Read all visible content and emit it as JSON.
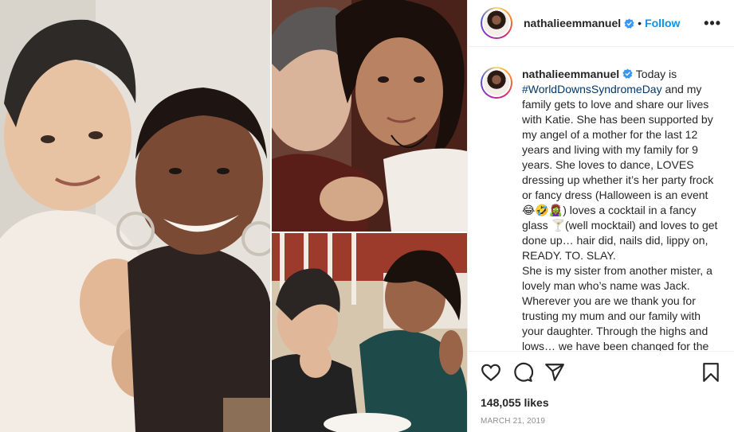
{
  "post": {
    "username": "nathalieemmanuel",
    "follow_label": "Follow",
    "separator": "•",
    "more_label": "•••",
    "caption": {
      "intro": " Today is",
      "hashtag": "#WorldDownsSyndromeDay",
      "body": " and my family gets to love and share our lives with Katie. She has been supported by my angel of a mother for the last 12 years and living with my family for 9 years. She loves to dance, LOVES dressing up whether it’s her party frock or fancy dress (Halloween is an event 😂🤣🧟‍♀️) loves a cocktail in a fancy glass 🍸(well mocktail) and loves to get done up… hair did, nails did, lippy on, READY. TO. SLAY.",
      "body2": "She is my sister from another mister, a lovely man who’s name was Jack. Wherever you are we thank you for trusting my mum and our family with your daughter. Through the highs and lows… we have been changed for the better because of her! Every day we laugh"
    },
    "likes": "148,055 likes",
    "date": "MARCH 21, 2019"
  },
  "icons": {
    "like": "heart-icon",
    "comment": "comment-icon",
    "share": "share-icon",
    "save": "bookmark-icon",
    "verified": "verified-badge-icon"
  },
  "colors": {
    "accent": "#0095f6",
    "verified": "#3897f0",
    "hashtag": "#00376b",
    "muted": "#8e8e8e"
  }
}
